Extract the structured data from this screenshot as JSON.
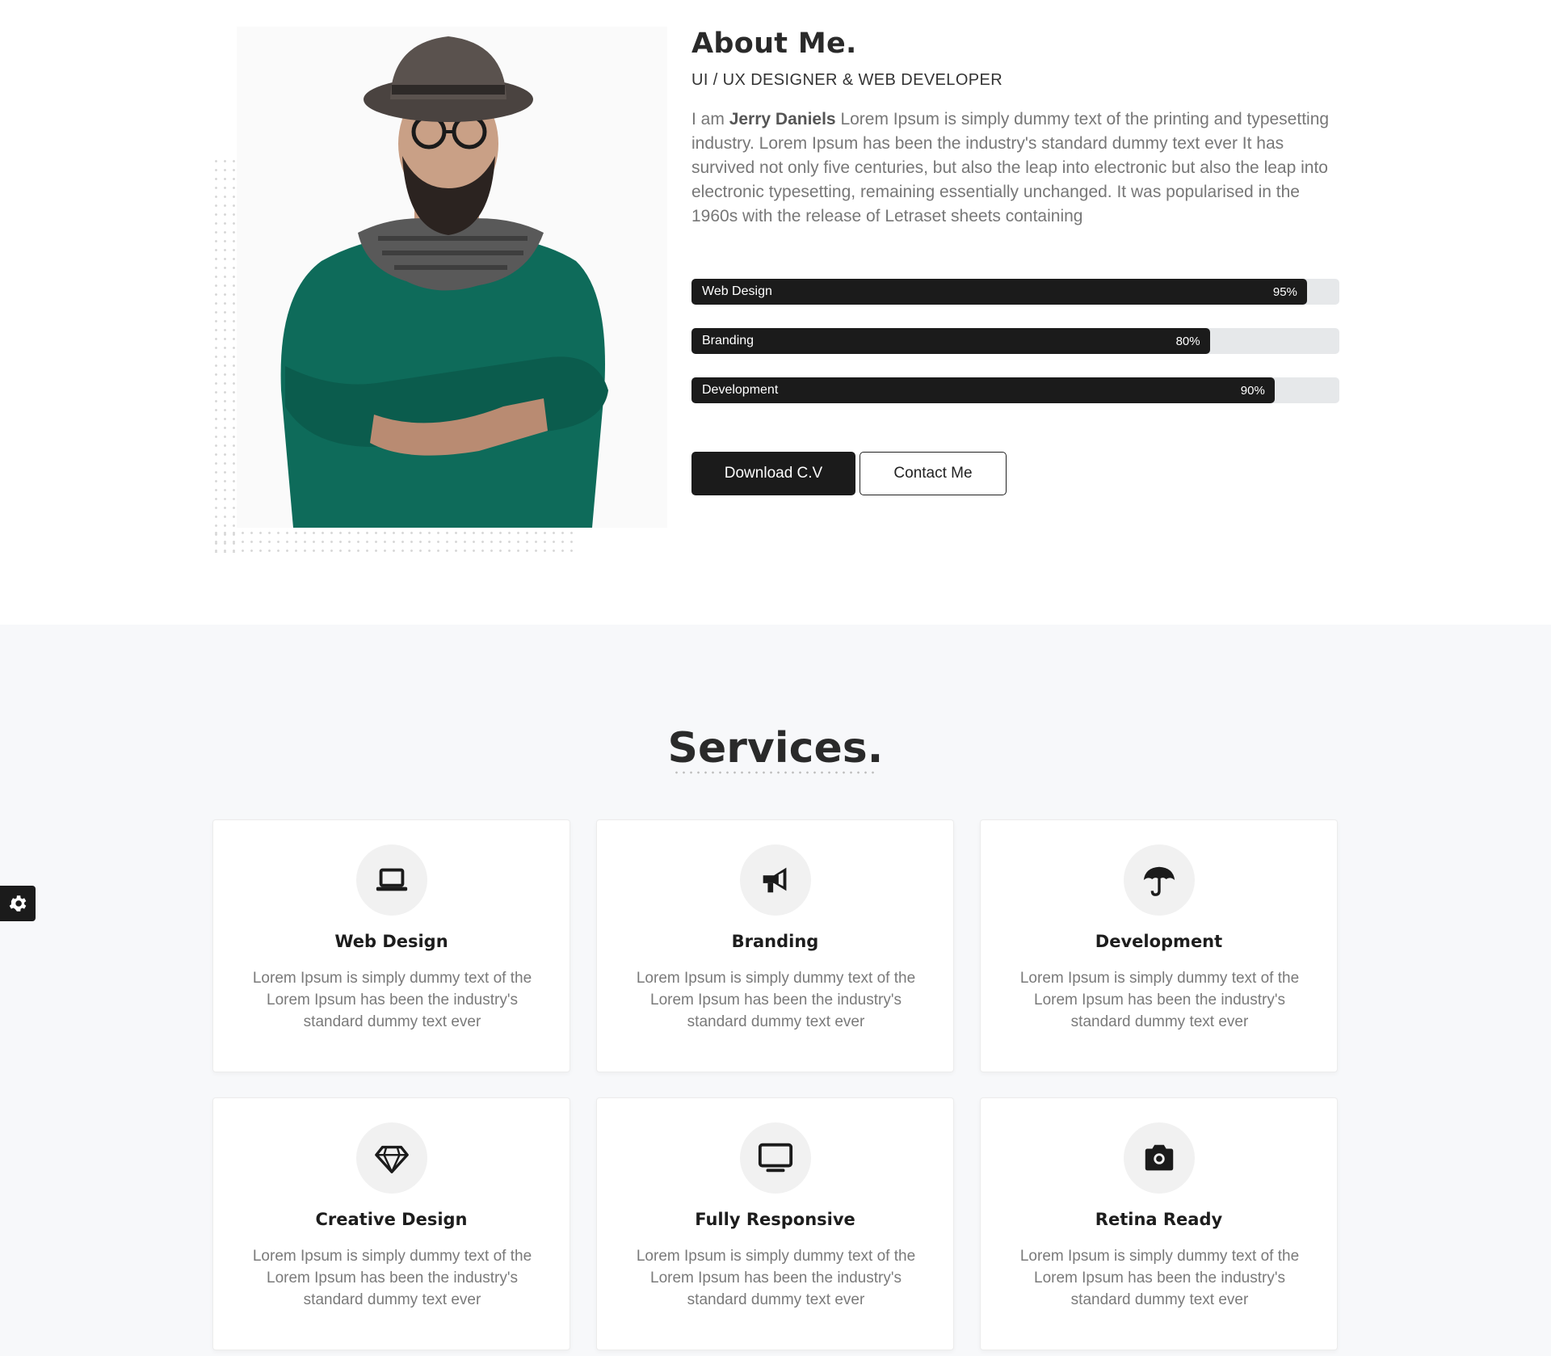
{
  "about": {
    "title": "About Me.",
    "subtitle": "UI / UX DESIGNER & WEB DEVELOPER",
    "intro_prefix": "I am",
    "name": "Jerry Daniels",
    "paragraph": "Lorem Ipsum is simply dummy text of the printing and typesetting industry. Lorem Ipsum has been the industry's standard dummy text ever It has survived not only five centuries, but also the leap into electronic but also the leap into electronic typesetting, remaining essentially unchanged. It was popularised in the 1960s with the release of Letraset sheets containing",
    "skills": [
      {
        "name": "Web Design",
        "percent_label": "95%",
        "level": 0.95
      },
      {
        "name": "Branding",
        "percent_label": "80%",
        "level": 0.8
      },
      {
        "name": "Development",
        "percent_label": "90%",
        "level": 0.9
      }
    ],
    "buttons": {
      "download": "Download C.V",
      "contact": "Contact Me"
    }
  },
  "services": {
    "title": "Services.",
    "cards": [
      {
        "icon": "laptop-icon",
        "title": "Web Design",
        "desc": "Lorem Ipsum is simply dummy text of the Lorem Ipsum has been the industry's standard dummy text ever"
      },
      {
        "icon": "megaphone-icon",
        "title": "Branding",
        "desc": "Lorem Ipsum is simply dummy text of the Lorem Ipsum has been the industry's standard dummy text ever"
      },
      {
        "icon": "umbrella-icon",
        "title": "Development",
        "desc": "Lorem Ipsum is simply dummy text of the Lorem Ipsum has been the industry's standard dummy text ever"
      },
      {
        "icon": "diamond-icon",
        "title": "Creative Design",
        "desc": "Lorem Ipsum is simply dummy text of the Lorem Ipsum has been the industry's standard dummy text ever"
      },
      {
        "icon": "desktop-icon",
        "title": "Fully Responsive",
        "desc": "Lorem Ipsum is simply dummy text of the Lorem Ipsum has been the industry's standard dummy text ever"
      },
      {
        "icon": "camera-icon",
        "title": "Retina Ready",
        "desc": "Lorem Ipsum is simply dummy text of the Lorem Ipsum has been the industry's standard dummy text ever"
      }
    ]
  },
  "settings": {
    "icon": "gear-icon"
  },
  "colors": {
    "accent": "#1b1b1b",
    "services_bg": "#f7f8fa",
    "track": "#e6e8ea"
  }
}
